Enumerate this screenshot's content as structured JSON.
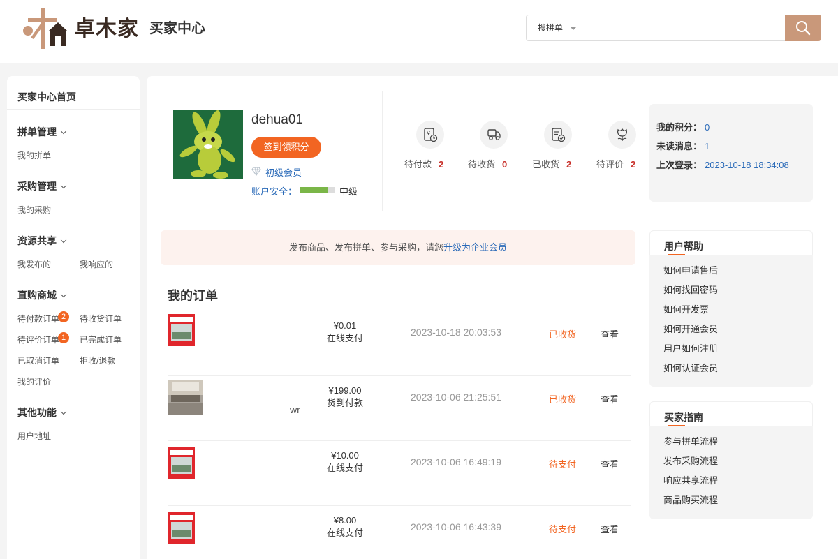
{
  "header": {
    "brand": "卓木家",
    "center_title": "买家中心",
    "search": {
      "type_label": "搜拼单",
      "value": "",
      "placeholder": ""
    },
    "accent": "#c9987a"
  },
  "sidebar": {
    "home": "买家中心首页",
    "groups": [
      {
        "title": "拼单管理",
        "links": [
          "我的拼单"
        ]
      },
      {
        "title": "采购管理",
        "links": [
          "我的采购"
        ]
      },
      {
        "title": "资源共享",
        "links": [
          "我发布的",
          "我响应的"
        ]
      },
      {
        "title": "直购商城",
        "links": [
          "待付款订单",
          "待收货订单",
          "待评价订单",
          "已完成订单",
          "已取消订单",
          "拒收/退款",
          "我的评价"
        ],
        "badges": [
          "2",
          "1"
        ]
      },
      {
        "title": "其他功能",
        "links": [
          "用户地址"
        ]
      }
    ]
  },
  "profile": {
    "username": "dehua01",
    "checkin_label": "签到领积分",
    "member_level": "初级会员",
    "security_label": "账户安全：",
    "security_level": "中级",
    "security_fraction": 0.8
  },
  "order_status": [
    {
      "label": "待付款",
      "count": "2",
      "icon": "pending-payment-icon"
    },
    {
      "label": "待收货",
      "count": "0",
      "icon": "delivery-truck-icon"
    },
    {
      "label": "已收货",
      "count": "2",
      "icon": "received-checklist-icon"
    },
    {
      "label": "待评价",
      "count": "2",
      "icon": "rate-flower-icon"
    }
  ],
  "info": {
    "points_label": "我的积分：",
    "points": "0",
    "unread_label": "未读消息：",
    "unread": "1",
    "last_login_label": "上次登录：",
    "last_login": "2023-10-18 18:34:08"
  },
  "notice": {
    "text": "发布商品、发布拼单、参与采购，请您",
    "link": "升级为企业会员"
  },
  "orders": {
    "title": "我的订单",
    "rows": [
      {
        "name": "",
        "amount": "¥0.01",
        "payment": "在线支付",
        "date": "2023-10-18 20:03:53",
        "status": "已收货",
        "action": "查看"
      },
      {
        "name": "wr",
        "amount": "¥199.00",
        "payment": "货到付款",
        "date": "2023-10-06 21:25:51",
        "status": "已收货",
        "action": "查看"
      },
      {
        "name": "",
        "amount": "¥10.00",
        "payment": "在线支付",
        "date": "2023-10-06 16:49:19",
        "status": "待支付",
        "action": "查看"
      },
      {
        "name": "",
        "amount": "¥8.00",
        "payment": "在线支付",
        "date": "2023-10-06 16:43:39",
        "status": "待支付",
        "action": "查看"
      }
    ]
  },
  "help": {
    "title": "用户帮助",
    "links": [
      "如何申请售后",
      "如何找回密码",
      "如何开发票",
      "如何开通会员",
      "用户如何注册",
      "如何认证会员"
    ]
  },
  "guide": {
    "title": "买家指南",
    "links": [
      "参与拼单流程",
      "发布采购流程",
      "响应共享流程",
      "商品购买流程"
    ]
  }
}
